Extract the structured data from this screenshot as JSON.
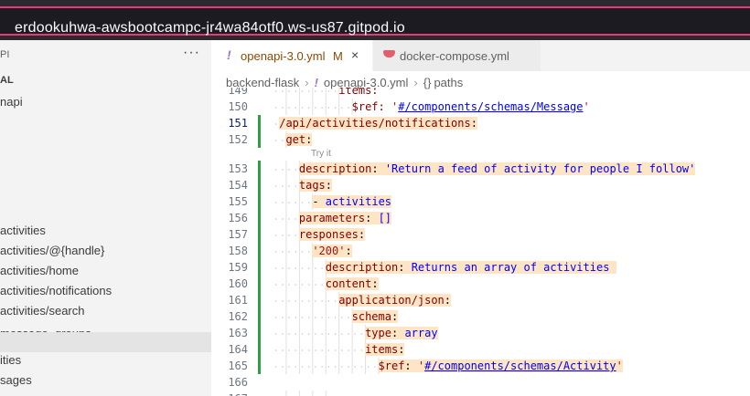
{
  "browser": {
    "url": "erdookuhwa-awsbootcampc-jr4wa84otf0.ws-us87.gitpod.io"
  },
  "sidebar": {
    "header": "PI",
    "more_icon": "ellipsis-icon",
    "section": "AL",
    "item": "napi",
    "routes": [
      "activities",
      "activities/@{handle}",
      "activities/home",
      "activities/notifications",
      "activities/search"
    ],
    "cut_route": "message_groups",
    "lower_items": [
      "ities",
      "sages"
    ]
  },
  "tabs": [
    {
      "icon": "!",
      "label": "openapi-3.0.yml",
      "modified": "M",
      "close": "×",
      "active": true
    },
    {
      "icon": "docker-whale-icon",
      "label": "docker-compose.yml",
      "active": false
    }
  ],
  "breadcrumb": {
    "folder": "backend-flask",
    "file_icon": "!",
    "file": "openapi-3.0.yml",
    "symbol_icon": "{}",
    "symbol": "paths"
  },
  "codelens": "Try it",
  "code_lines": [
    {
      "n": "149",
      "cut": true,
      "indent": 10,
      "parts": [
        [
          "k",
          "items:"
        ]
      ]
    },
    {
      "n": "150",
      "indent": 12,
      "parts": [
        [
          "k",
          "$ref: "
        ],
        [
          "s",
          "'"
        ],
        [
          "u",
          "#/components/schemas/Message"
        ],
        [
          "s",
          "'"
        ]
      ]
    },
    {
      "n": "151",
      "hl": true,
      "git": true,
      "active": true,
      "indent": 1,
      "parts": [
        [
          "k",
          "/api/activities/notifications"
        ],
        [
          "p",
          ":"
        ]
      ]
    },
    {
      "n": "152",
      "hl": true,
      "git": true,
      "indent": 2,
      "parts": [
        [
          "k",
          "get"
        ],
        [
          "p",
          ":"
        ]
      ]
    },
    {
      "n": "153",
      "hl": true,
      "git": true,
      "indent": 4,
      "parts": [
        [
          "k",
          "description"
        ],
        [
          "p",
          ": "
        ],
        [
          "v",
          "'Return a feed of activity for people I follow'"
        ]
      ]
    },
    {
      "n": "154",
      "hl": true,
      "git": true,
      "indent": 4,
      "parts": [
        [
          "k",
          "tags"
        ],
        [
          "p",
          ":"
        ]
      ]
    },
    {
      "n": "155",
      "hl": true,
      "git": true,
      "indent": 6,
      "parts": [
        [
          "p",
          "- "
        ],
        [
          "v",
          "activities"
        ]
      ]
    },
    {
      "n": "156",
      "hl": true,
      "git": true,
      "indent": 4,
      "parts": [
        [
          "k",
          "parameters"
        ],
        [
          "p",
          ": "
        ],
        [
          "v",
          "[]"
        ]
      ]
    },
    {
      "n": "157",
      "hl": true,
      "git": true,
      "indent": 4,
      "parts": [
        [
          "k",
          "responses"
        ],
        [
          "p",
          ":"
        ]
      ]
    },
    {
      "n": "158",
      "hl": true,
      "git": true,
      "indent": 6,
      "parts": [
        [
          "s",
          "'200'"
        ],
        [
          "p",
          ":"
        ]
      ]
    },
    {
      "n": "159",
      "hl": true,
      "git": true,
      "indent": 8,
      "parts": [
        [
          "k",
          "description"
        ],
        [
          "p",
          ": "
        ],
        [
          "v",
          "Returns an array of activities "
        ]
      ]
    },
    {
      "n": "160",
      "hl": true,
      "git": true,
      "indent": 8,
      "parts": [
        [
          "k",
          "content"
        ],
        [
          "p",
          ":"
        ]
      ]
    },
    {
      "n": "161",
      "hl": true,
      "git": true,
      "indent": 10,
      "parts": [
        [
          "k",
          "application/json"
        ],
        [
          "p",
          ":"
        ]
      ]
    },
    {
      "n": "162",
      "hl": true,
      "git": true,
      "indent": 12,
      "parts": [
        [
          "k",
          "schema"
        ],
        [
          "p",
          ":"
        ]
      ]
    },
    {
      "n": "163",
      "hl": true,
      "git": true,
      "indent": 14,
      "parts": [
        [
          "k",
          "type"
        ],
        [
          "p",
          ": "
        ],
        [
          "v",
          "array"
        ]
      ]
    },
    {
      "n": "164",
      "hl": true,
      "git": true,
      "indent": 14,
      "parts": [
        [
          "k",
          "items"
        ],
        [
          "p",
          ":"
        ]
      ]
    },
    {
      "n": "165",
      "hl": true,
      "git": true,
      "indent": 16,
      "parts": [
        [
          "k",
          "$ref"
        ],
        [
          "p",
          ": "
        ],
        [
          "s",
          "'"
        ],
        [
          "u",
          "#/components/schemas/Activity"
        ],
        [
          "s",
          "'"
        ]
      ]
    },
    {
      "n": "166",
      "indent": 0,
      "parts": []
    },
    {
      "n": "167",
      "cut": true,
      "indent": 8,
      "parts": [
        [
          "k",
          "."
        ]
      ]
    }
  ],
  "colors": {
    "highlight": "#fde5c6",
    "git_added": "#2ea043",
    "url_focus_ring": "#e83a7a"
  }
}
